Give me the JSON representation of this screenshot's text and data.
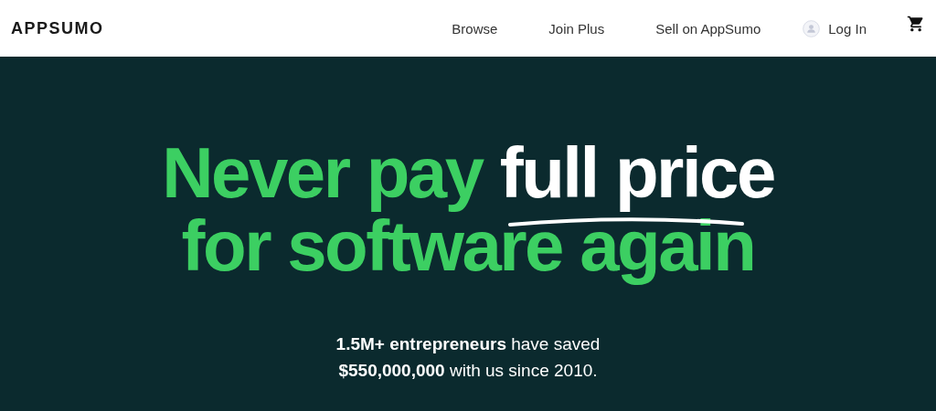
{
  "header": {
    "logo": "APPSUMO",
    "nav": [
      {
        "label": "Browse"
      },
      {
        "label": "Join Plus"
      },
      {
        "label": "Sell on AppSumo"
      }
    ],
    "login": "Log In"
  },
  "hero": {
    "headline_lines": [
      {
        "text": "Never pay ",
        "highlight": "full price"
      },
      {
        "text": "for software again"
      }
    ],
    "subtext_lines": [
      "**1.5M+ entrepreneurs** have saved",
      "**$550,000,000** with us since 2010."
    ]
  }
}
